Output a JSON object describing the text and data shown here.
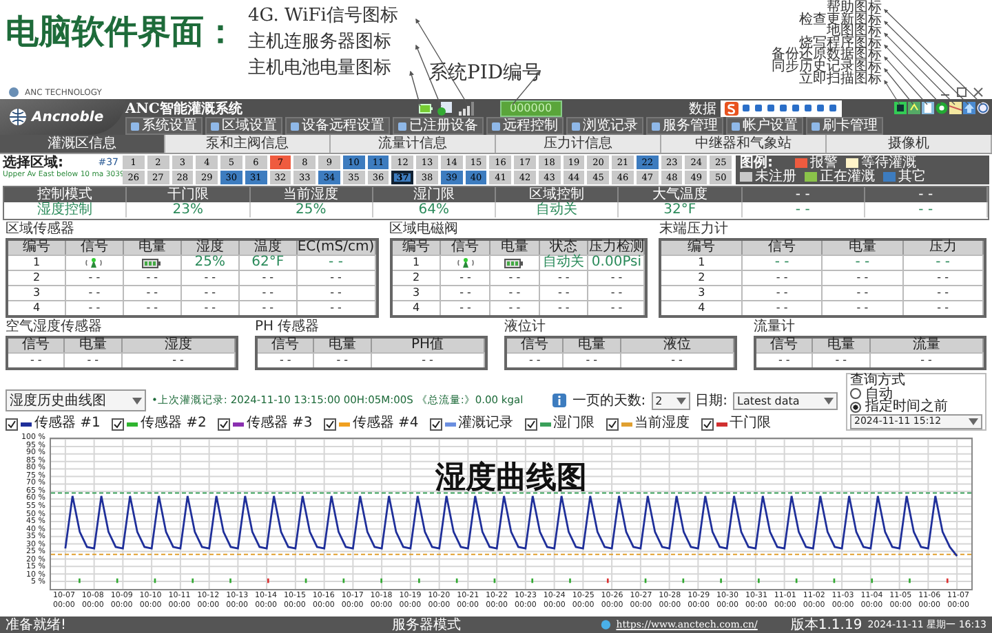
{
  "annotations": {
    "title": "电脑软件界面：",
    "left_notes": [
      "4G. WiFi信号图标",
      "主机连服务器图标",
      "主机电池电量图标"
    ],
    "pid_note": "系统PID编号",
    "right_notes": [
      "帮助图标",
      "检查更新图标",
      "地图图标",
      "烧写程序图标",
      "备份还原数据图标",
      "同步历史记录图标",
      "立即扫描图标"
    ],
    "chart_note": "湿度曲线图"
  },
  "window": {
    "title": "ANC TECHNOLOGY",
    "app_name": "ANC智能灌溉系统",
    "logo_text": "Ancnoble",
    "pid": "000000",
    "ime_label": "数据"
  },
  "toolbar": [
    "系统设置",
    "区域设置",
    "设备远程设置",
    "已注册设备",
    "远程控制",
    "浏览记录",
    "服务管理",
    "帐户设置",
    "刷卡管理"
  ],
  "tabs": [
    {
      "label": "灌溉区信息",
      "selected": true
    },
    {
      "label": "泵和主阀信息",
      "selected": false
    },
    {
      "label": "流量计信息",
      "selected": false
    },
    {
      "label": "压力计信息",
      "selected": false
    },
    {
      "label": "中继器和气象站",
      "selected": false
    },
    {
      "label": "摄像机",
      "selected": false
    }
  ],
  "zone_picker": {
    "label": "选择区域:",
    "current": "#37",
    "description": "Upper Av East below 10 ma 3039",
    "zones": [
      {
        "label": "1",
        "color": "#c9c9c9",
        "selected": false
      },
      {
        "label": "2",
        "color": "#c9c9c9",
        "selected": false
      },
      {
        "label": "3",
        "color": "#c9c9c9",
        "selected": false
      },
      {
        "label": "4",
        "color": "#c9c9c9",
        "selected": false
      },
      {
        "label": "5",
        "color": "#c9c9c9",
        "selected": false
      },
      {
        "label": "6",
        "color": "#c9c9c9",
        "selected": false
      },
      {
        "label": "7",
        "color": "#ef5b3f",
        "selected": false
      },
      {
        "label": "8",
        "color": "#c9c9c9",
        "selected": false
      },
      {
        "label": "9",
        "color": "#c9c9c9",
        "selected": false
      },
      {
        "label": "10",
        "color": "#3d7cbf",
        "selected": false
      },
      {
        "label": "11",
        "color": "#3d7cbf",
        "selected": false
      },
      {
        "label": "12",
        "color": "#c9c9c9",
        "selected": false
      },
      {
        "label": "13",
        "color": "#c9c9c9",
        "selected": false
      },
      {
        "label": "14",
        "color": "#c9c9c9",
        "selected": false
      },
      {
        "label": "15",
        "color": "#c9c9c9",
        "selected": false
      },
      {
        "label": "16",
        "color": "#c9c9c9",
        "selected": false
      },
      {
        "label": "17",
        "color": "#c9c9c9",
        "selected": false
      },
      {
        "label": "18",
        "color": "#c9c9c9",
        "selected": false
      },
      {
        "label": "19",
        "color": "#c9c9c9",
        "selected": false
      },
      {
        "label": "20",
        "color": "#c9c9c9",
        "selected": false
      },
      {
        "label": "21",
        "color": "#c9c9c9",
        "selected": false
      },
      {
        "label": "22",
        "color": "#3d7cbf",
        "selected": false
      },
      {
        "label": "23",
        "color": "#c9c9c9",
        "selected": false
      },
      {
        "label": "24",
        "color": "#c9c9c9",
        "selected": false
      },
      {
        "label": "25",
        "color": "#c9c9c9",
        "selected": false
      },
      {
        "label": "26",
        "color": "#c9c9c9",
        "selected": false
      },
      {
        "label": "27",
        "color": "#c9c9c9",
        "selected": false
      },
      {
        "label": "28",
        "color": "#c9c9c9",
        "selected": false
      },
      {
        "label": "29",
        "color": "#c9c9c9",
        "selected": false
      },
      {
        "label": "30",
        "color": "#3d7cbf",
        "selected": false
      },
      {
        "label": "31",
        "color": "#3d7cbf",
        "selected": false
      },
      {
        "label": "32",
        "color": "#c9c9c9",
        "selected": false
      },
      {
        "label": "33",
        "color": "#c9c9c9",
        "selected": false
      },
      {
        "label": "34",
        "color": "#3d7cbf",
        "selected": false
      },
      {
        "label": "35",
        "color": "#c9c9c9",
        "selected": false
      },
      {
        "label": "36",
        "color": "#c9c9c9",
        "selected": false
      },
      {
        "label": "37",
        "color": "#3d7cbf",
        "selected": true
      },
      {
        "label": "38",
        "color": "#c9c9c9",
        "selected": false
      },
      {
        "label": "39",
        "color": "#3d7cbf",
        "selected": false
      },
      {
        "label": "40",
        "color": "#3d7cbf",
        "selected": false
      },
      {
        "label": "41",
        "color": "#c9c9c9",
        "selected": false
      },
      {
        "label": "42",
        "color": "#c9c9c9",
        "selected": false
      },
      {
        "label": "43",
        "color": "#c9c9c9",
        "selected": false
      },
      {
        "label": "44",
        "color": "#c9c9c9",
        "selected": false
      },
      {
        "label": "45",
        "color": "#c9c9c9",
        "selected": false
      },
      {
        "label": "46",
        "color": "#c9c9c9",
        "selected": false
      },
      {
        "label": "47",
        "color": "#c9c9c9",
        "selected": false
      },
      {
        "label": "48",
        "color": "#c9c9c9",
        "selected": false
      },
      {
        "label": "49",
        "color": "#c9c9c9",
        "selected": false
      },
      {
        "label": "50",
        "color": "#c9c9c9",
        "selected": false
      }
    ]
  },
  "zone_legend": {
    "title": "图例:",
    "items": [
      {
        "label": "报警",
        "color": "#ef5b3f"
      },
      {
        "label": "等待灌溉",
        "color": "#fff3c8"
      },
      {
        "label": "未注册",
        "color": "#c9c9c9"
      },
      {
        "label": "正在灌溉",
        "color": "#8bc34a"
      },
      {
        "label": "其它",
        "color": "#3d7cbf"
      }
    ]
  },
  "control_summary": {
    "columns": [
      "控制模式",
      "干门限",
      "当前湿度",
      "湿门限",
      "区域控制",
      "大气温度",
      "- -",
      "- -"
    ],
    "values": [
      "湿度控制",
      "23%",
      "25%",
      "64%",
      "自动关",
      "32°F",
      "- -",
      "- -"
    ]
  },
  "sensor_panels": [
    {
      "title": "区域传感器",
      "columns": [
        "编号",
        "信号",
        "电量",
        "湿度",
        "温度",
        "EC(mS/cm)"
      ],
      "rows": [
        [
          {
            "kind": "text",
            "text": "1"
          },
          {
            "kind": "signal"
          },
          {
            "kind": "battery"
          },
          {
            "kind": "text",
            "text": "25%"
          },
          {
            "kind": "text",
            "text": "62°F"
          },
          {
            "kind": "text",
            "text": "- -"
          }
        ],
        [
          {
            "kind": "text",
            "text": "2"
          },
          {
            "kind": "text",
            "text": "- -"
          },
          {
            "kind": "text",
            "text": "- -"
          },
          {
            "kind": "text",
            "text": "- -"
          },
          {
            "kind": "text",
            "text": "- -"
          },
          {
            "kind": "text",
            "text": "- -"
          }
        ],
        [
          {
            "kind": "text",
            "text": "3"
          },
          {
            "kind": "text",
            "text": "- -"
          },
          {
            "kind": "text",
            "text": "- -"
          },
          {
            "kind": "text",
            "text": "- -"
          },
          {
            "kind": "text",
            "text": "- -"
          },
          {
            "kind": "text",
            "text": "- -"
          }
        ],
        [
          {
            "kind": "text",
            "text": "4"
          },
          {
            "kind": "text",
            "text": "- -"
          },
          {
            "kind": "text",
            "text": "- -"
          },
          {
            "kind": "text",
            "text": "- -"
          },
          {
            "kind": "text",
            "text": "- -"
          },
          {
            "kind": "text",
            "text": "- -"
          }
        ]
      ]
    },
    {
      "title": "区域电磁阀",
      "columns": [
        "编号",
        "信号",
        "电量",
        "状态",
        "压力检测"
      ],
      "rows": [
        [
          {
            "kind": "text",
            "text": "1"
          },
          {
            "kind": "signal"
          },
          {
            "kind": "battery"
          },
          {
            "kind": "text",
            "text": "自动关"
          },
          {
            "kind": "text",
            "text": "0.00Psi"
          }
        ],
        [
          {
            "kind": "text",
            "text": "2"
          },
          {
            "kind": "text",
            "text": "- -"
          },
          {
            "kind": "text",
            "text": "- -"
          },
          {
            "kind": "text",
            "text": "- -"
          },
          {
            "kind": "text",
            "text": "- -"
          }
        ],
        [
          {
            "kind": "text",
            "text": "3"
          },
          {
            "kind": "text",
            "text": "- -"
          },
          {
            "kind": "text",
            "text": "- -"
          },
          {
            "kind": "text",
            "text": "- -"
          },
          {
            "kind": "text",
            "text": "- -"
          }
        ],
        [
          {
            "kind": "text",
            "text": "4"
          },
          {
            "kind": "text",
            "text": "- -"
          },
          {
            "kind": "text",
            "text": "- -"
          },
          {
            "kind": "text",
            "text": "- -"
          },
          {
            "kind": "text",
            "text": "- -"
          }
        ]
      ]
    },
    {
      "title": "末端压力计",
      "columns": [
        "编号",
        "信号",
        "电量",
        "压力"
      ],
      "rows": [
        [
          {
            "kind": "text",
            "text": "1"
          },
          {
            "kind": "text",
            "text": "- -"
          },
          {
            "kind": "text",
            "text": "- -"
          },
          {
            "kind": "text",
            "text": "- -"
          }
        ],
        [
          {
            "kind": "text",
            "text": "2"
          },
          {
            "kind": "text",
            "text": "- -"
          },
          {
            "kind": "text",
            "text": "- -"
          },
          {
            "kind": "text",
            "text": "- -"
          }
        ],
        [
          {
            "kind": "text",
            "text": "3"
          },
          {
            "kind": "text",
            "text": "- -"
          },
          {
            "kind": "text",
            "text": "- -"
          },
          {
            "kind": "text",
            "text": "- -"
          }
        ],
        [
          {
            "kind": "text",
            "text": "4"
          },
          {
            "kind": "text",
            "text": "- -"
          },
          {
            "kind": "text",
            "text": "- -"
          },
          {
            "kind": "text",
            "text": "- -"
          }
        ]
      ]
    }
  ],
  "small_panels": [
    {
      "title": "空气湿度传感器",
      "columns": [
        "信号",
        "电量",
        "湿度"
      ],
      "values": [
        "- -",
        "- -",
        "- -"
      ]
    },
    {
      "title": "PH 传感器",
      "columns": [
        "信号",
        "电量",
        "PH值"
      ],
      "values": [
        "- -",
        "- -",
        "- -"
      ]
    },
    {
      "title": "液位计",
      "columns": [
        "信号",
        "电量",
        "液位"
      ],
      "values": [
        "- -",
        "- -",
        "- -"
      ]
    },
    {
      "title": "流量计",
      "columns": [
        "信号",
        "电量",
        "流量"
      ],
      "values": [
        "- -",
        "- -",
        "- -"
      ]
    }
  ],
  "chart_controls": {
    "view": "湿度历史曲线图",
    "last_record": "•上次灌溉记录: 2024-11-10 13:15:00  00H:05M:00S 《总流量:》0.00 kgal",
    "legend": [
      {
        "label": "传感器 #1",
        "checked": true,
        "color": "#1f2f9a"
      },
      {
        "label": "传感器 #2",
        "checked": true,
        "color": "#2fb52f"
      },
      {
        "label": "传感器 #3",
        "checked": true,
        "color": "#8a2fb0"
      },
      {
        "label": "传感器 #4",
        "checked": true,
        "color": "#f0a020"
      },
      {
        "label": "灌溉记录",
        "checked": true,
        "color": "#6b8fe0"
      },
      {
        "label": "湿门限",
        "checked": true,
        "color": "#3aa05a"
      },
      {
        "label": "当前湿度",
        "checked": true,
        "color": "#e0a030"
      },
      {
        "label": "干门限",
        "checked": true,
        "color": "#d03030"
      }
    ],
    "days_label": "一页的天数:",
    "days": "2",
    "date_label": "日期:",
    "date": "Latest data",
    "query_title": "查询方式",
    "query_modes": [
      {
        "label": "自动",
        "selected": false
      },
      {
        "label": "指定时间之前",
        "selected": true
      }
    ],
    "query_time": "2024-11-11 15:12"
  },
  "chart": {
    "chart_data": {
      "type": "line",
      "ylim": [
        0,
        100
      ],
      "grid": true,
      "ref_lines": [
        {
          "axis": "y",
          "value": 64,
          "color": "#3aa05a"
        },
        {
          "axis": "y",
          "value": 23,
          "color": "#e0a030"
        }
      ],
      "yticks": [
        {
          "value": 100,
          "label": "100 %"
        },
        {
          "value": 95,
          "label": "95 %"
        },
        {
          "value": 90,
          "label": "90 %"
        },
        {
          "value": 85,
          "label": "85 %"
        },
        {
          "value": 80,
          "label": "80 %"
        },
        {
          "value": 75,
          "label": "75 %"
        },
        {
          "value": 70,
          "label": "70 %"
        },
        {
          "value": 65,
          "label": "65 %"
        },
        {
          "value": 60,
          "label": "60 %"
        },
        {
          "value": 55,
          "label": "55 %"
        },
        {
          "value": 50,
          "label": "50 %"
        },
        {
          "value": 45,
          "label": "45 %"
        },
        {
          "value": 40,
          "label": "40 %"
        },
        {
          "value": 35,
          "label": "35 %"
        },
        {
          "value": 30,
          "label": "30 %"
        },
        {
          "value": 25,
          "label": "25 %"
        },
        {
          "value": 20,
          "label": "20 %"
        },
        {
          "value": 15,
          "label": "15 %"
        },
        {
          "value": 10,
          "label": "10 %"
        },
        {
          "value": 5,
          "label": "5 %"
        }
      ],
      "categories": [
        "10-07\n00:00",
        null,
        null,
        null,
        "10-08\n00:00",
        null,
        null,
        null,
        "10-09\n00:00",
        null,
        null,
        null,
        "10-10\n00:00",
        null,
        null,
        null,
        "10-11\n00:00",
        null,
        null,
        null,
        "10-12\n00:00",
        null,
        null,
        null,
        "10-13\n00:00",
        null,
        null,
        null,
        "10-14\n00:00",
        null,
        null,
        null,
        "10-15\n00:00",
        null,
        null,
        null,
        "10-16\n00:00",
        null,
        null,
        null,
        "10-17\n00:00",
        null,
        null,
        null,
        "10-18\n00:00",
        null,
        null,
        null,
        "10-19\n00:00",
        null,
        null,
        null,
        "10-20\n00:00",
        null,
        null,
        null,
        "10-21\n00:00",
        null,
        null,
        null,
        "10-22\n00:00",
        null,
        null,
        null,
        "10-23\n00:00",
        null,
        null,
        null,
        "10-24\n00:00",
        null,
        null,
        null,
        "10-25\n00:00",
        null,
        null,
        null,
        "10-26\n00:00",
        null,
        null,
        null,
        "10-27\n00:00",
        null,
        null,
        null,
        "10-28\n00:00",
        null,
        null,
        null,
        "10-29\n00:00",
        null,
        null,
        null,
        "10-30\n00:00",
        null,
        null,
        null,
        "10-31\n00:00",
        null,
        null,
        null,
        "11-01\n00:00",
        null,
        null,
        null,
        "11-02\n00:00",
        null,
        null,
        null,
        "11-03\n00:00",
        null,
        null,
        null,
        "11-04\n00:00",
        null,
        null,
        null,
        "11-05\n00:00",
        null,
        null,
        null,
        "11-06\n00:00",
        null,
        null,
        null,
        "11-07\n00:00"
      ],
      "series": [
        {
          "color": "#1f2f9a",
          "values": [
            27,
            62,
            38,
            28,
            27,
            62,
            38,
            28,
            27,
            62,
            38,
            28,
            27,
            62,
            38,
            28,
            27,
            62,
            38,
            28,
            27,
            62,
            38,
            28,
            27,
            62,
            38,
            28,
            27,
            62,
            38,
            28,
            27,
            62,
            38,
            28,
            27,
            62,
            38,
            28,
            27,
            62,
            38,
            28,
            27,
            62,
            38,
            28,
            27,
            62,
            38,
            28,
            27,
            62,
            38,
            28,
            27,
            62,
            38,
            28,
            27,
            62,
            38,
            28,
            27,
            62,
            38,
            28,
            27,
            62,
            38,
            28,
            27,
            62,
            38,
            28,
            27,
            62,
            38,
            28,
            27,
            62,
            38,
            28,
            27,
            62,
            38,
            28,
            27,
            62,
            38,
            28,
            27,
            62,
            38,
            28,
            27,
            62,
            38,
            28,
            27,
            62,
            38,
            28,
            27,
            62,
            38,
            28,
            27,
            62,
            38,
            28,
            27,
            62,
            38,
            28,
            27,
            62,
            38,
            28,
            27,
            62,
            38,
            28,
            22
          ]
        }
      ]
    }
  },
  "status_bar": {
    "message": "准备就绪!",
    "mode": "服务器模式",
    "url": "https://www.anctech.com.cn/",
    "version": "版本1.1.19",
    "datetime": "2024-11-11  星期一  16:13"
  }
}
